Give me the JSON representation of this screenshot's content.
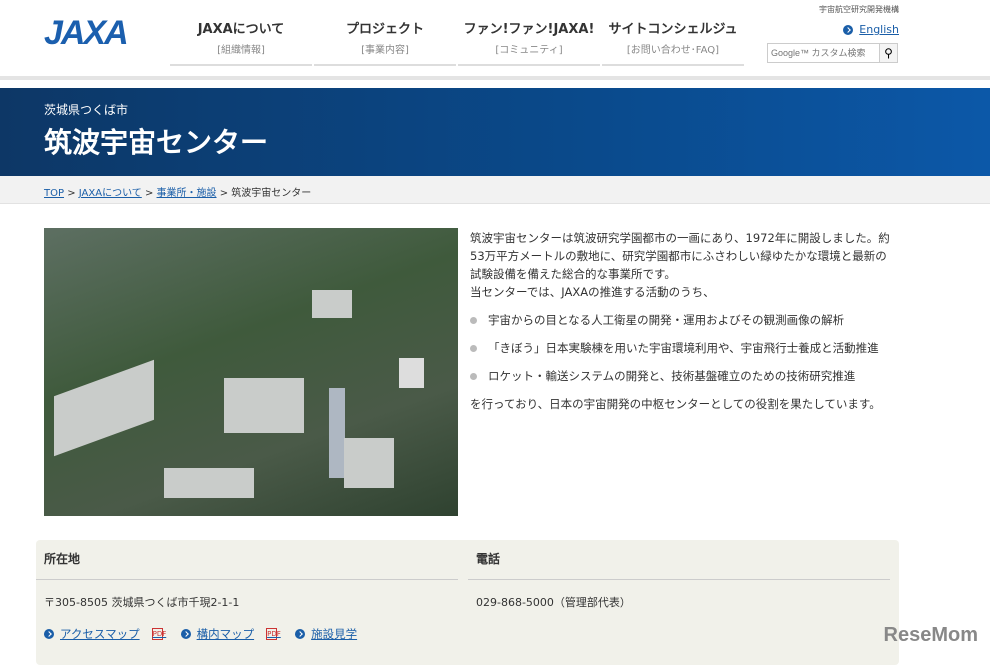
{
  "header": {
    "logo": "JAXA",
    "org_name": "宇宙航空研究開発機構",
    "english": "English",
    "search_placeholder": "Google™ カスタム検索",
    "nav": [
      {
        "main": "JAXAについて",
        "sub": "[組織情報]"
      },
      {
        "main": "プロジェクト",
        "sub": "[事業内容]"
      },
      {
        "main": "ファン!ファン!JAXA!",
        "sub": "[コミュニティ]"
      },
      {
        "main": "サイトコンシェルジュ",
        "sub": "[お問い合わせ･FAQ]"
      }
    ]
  },
  "hero": {
    "location": "茨城県つくば市",
    "title": "筑波宇宙センター"
  },
  "breadcrumb": [
    {
      "label": "TOP"
    },
    {
      "label": "JAXAについて"
    },
    {
      "label": "事業所・施設"
    },
    {
      "label": "筑波宇宙センター"
    }
  ],
  "description": {
    "intro": "筑波宇宙センターは筑波研究学園都市の一画にあり、1972年に開設しました。約53万平方メートルの敷地に、研究学園都市にふさわしい緑ゆたかな環境と最新の試験設備を備えた総合的な事業所です。",
    "intro2": "当センターでは、JAXAの推進する活動のうち、",
    "items": [
      "宇宙からの目となる人工衛星の開発・運用およびその観測画像の解析",
      "「きぼう」日本実験棟を用いた宇宙環境利用や、宇宙飛行士養成と活動推進",
      "ロケット・輸送システムの開発と、技術基盤確立のための技術研究推進"
    ],
    "outro": "を行っており、日本の宇宙開発の中枢センターとしての役割を果たしています。"
  },
  "info": {
    "address_label": "所在地",
    "address": "〒305-8505 茨城県つくば市千現2-1-1",
    "phone_label": "電話",
    "phone": "029-868-5000（管理部代表）",
    "links": [
      {
        "label": "アクセスマップ",
        "pdf": "PDF"
      },
      {
        "label": "構内マップ",
        "pdf": "PDF"
      },
      {
        "label": "施設見学"
      }
    ]
  },
  "watermark": "ReseMom"
}
